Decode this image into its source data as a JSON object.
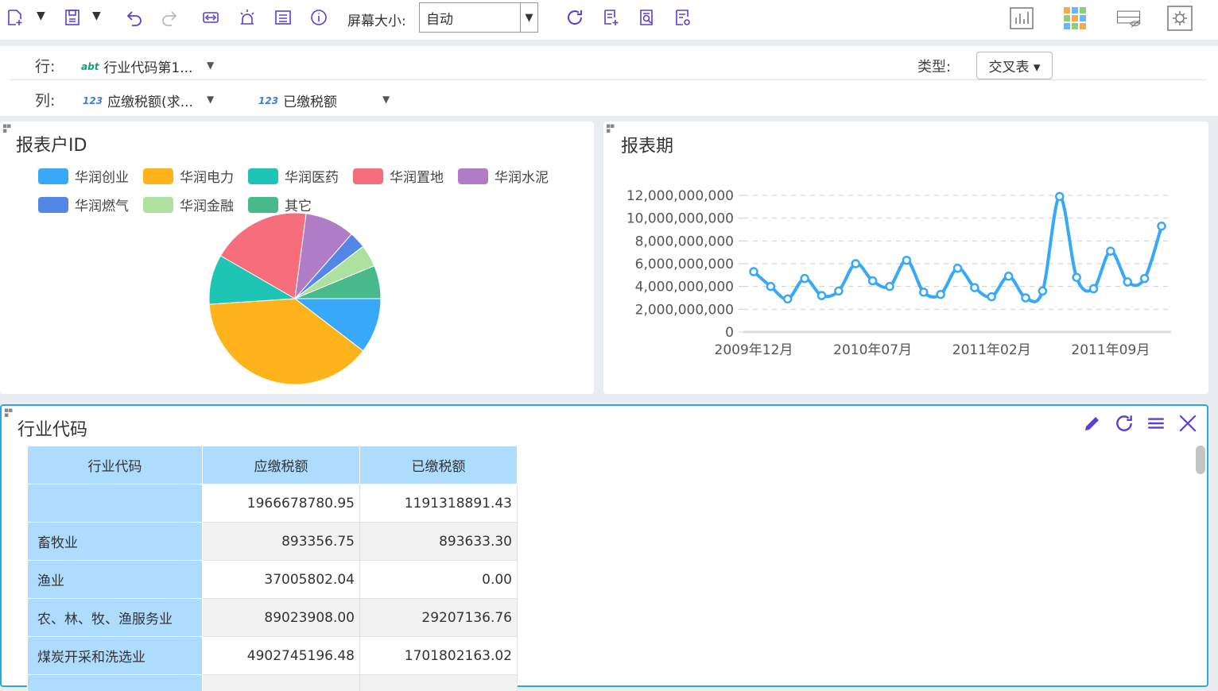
{
  "toolbar": {
    "screen_size_label": "屏幕大小:",
    "screen_size_value": "自动",
    "icons": [
      "new-icon",
      "save-icon",
      "undo-icon",
      "redo-icon",
      "link-icon",
      "alarm-icon",
      "list-icon",
      "info-icon",
      "refresh-icon",
      "add-report-icon",
      "preview-icon",
      "settings-report-icon",
      "chart-view-icon",
      "grid-view-icon",
      "hide-view-icon",
      "gear-icon"
    ]
  },
  "config": {
    "row_label": "行:",
    "row_field": "行业代码第1...",
    "col_label": "列:",
    "col_field1": "应缴税额(求...",
    "col_field2": "已缴税额",
    "tag_text": "abt",
    "tag_num": "123",
    "type_label": "类型:",
    "type_value": "交叉表 ▾"
  },
  "pie_panel": {
    "title": "报表户ID",
    "legend": [
      {
        "name": "华润创业",
        "color": "#38a8f8"
      },
      {
        "name": "华润电力",
        "color": "#ffb31a"
      },
      {
        "name": "华润医药",
        "color": "#1ec4b4"
      },
      {
        "name": "华润置地",
        "color": "#f66e7b"
      },
      {
        "name": "华润水泥",
        "color": "#b07cc6"
      },
      {
        "name": "华润燃气",
        "color": "#5387e6"
      },
      {
        "name": "华润金融",
        "color": "#aee0a0"
      },
      {
        "name": "其它",
        "color": "#48b98a"
      }
    ]
  },
  "line_panel": {
    "title": "报表期"
  },
  "table_panel": {
    "title": "行业代码",
    "headers": [
      "行业代码",
      "应缴税额",
      "已缴税额"
    ],
    "rows": [
      [
        "",
        "1966678780.95",
        "1191318891.43"
      ],
      [
        "畜牧业",
        "893356.75",
        "893633.30"
      ],
      [
        "渔业",
        "37005802.04",
        "0.00"
      ],
      [
        "农、林、牧、渔服务业",
        "89023908.00",
        "29207136.76"
      ],
      [
        "煤炭开采和洗选业",
        "4902745196.48",
        "1701802163.02"
      ]
    ]
  },
  "chart_data": [
    {
      "type": "pie",
      "title": "报表户ID",
      "categories": [
        "华润创业",
        "华润电力",
        "华润医药",
        "华润置地",
        "华润水泥",
        "华润燃气",
        "华润金融",
        "其它"
      ],
      "values": [
        10,
        37,
        9,
        18,
        9,
        3,
        4,
        6
      ]
    },
    {
      "type": "line",
      "title": "报表期",
      "x_tick_labels": [
        "2009年12月",
        "2010年07月",
        "2011年02月",
        "2011年09月"
      ],
      "y_tick_labels": [
        "0",
        "2,000,000,000",
        "4,000,000,000",
        "6,000,000,000",
        "8,000,000,000",
        "10,000,000,000",
        "12,000,000,000"
      ],
      "ylim": [
        0,
        12000000000
      ],
      "series": [
        {
          "values": [
            5300000000,
            4000000000,
            2900000000,
            4700000000,
            3200000000,
            3600000000,
            6000000000,
            4500000000,
            4000000000,
            6300000000,
            3500000000,
            3300000000,
            5600000000,
            3900000000,
            3100000000,
            4900000000,
            3000000000,
            3600000000,
            11900000000,
            4800000000,
            3800000000,
            7100000000,
            4400000000,
            4700000000,
            9300000000
          ]
        }
      ],
      "color": "#38a8f8",
      "grid": "dashed horizontal"
    }
  ]
}
